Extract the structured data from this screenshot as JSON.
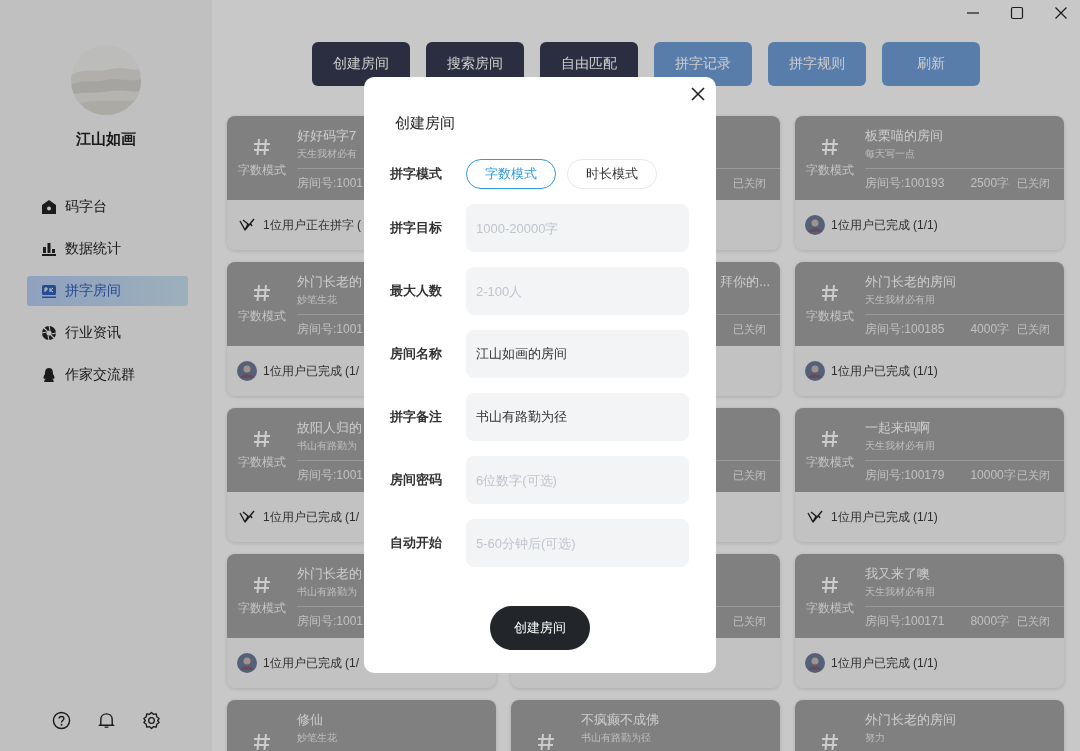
{
  "sidebar": {
    "user_name": "江山如画",
    "nav": [
      {
        "label": "码字台",
        "selected": false
      },
      {
        "label": "数据统计",
        "selected": false
      },
      {
        "label": "拼字房间",
        "selected": true
      },
      {
        "label": "行业资讯",
        "selected": false
      },
      {
        "label": "作家交流群",
        "selected": false
      }
    ]
  },
  "toolbar": [
    {
      "label": "创建房间",
      "kind": "dark"
    },
    {
      "label": "搜索房间",
      "kind": "dark"
    },
    {
      "label": "自由匹配",
      "kind": "dark"
    },
    {
      "label": "拼字记录",
      "kind": "light"
    },
    {
      "label": "拼字规则",
      "kind": "light"
    },
    {
      "label": "刷新",
      "kind": "light"
    }
  ],
  "rooms": [
    {
      "kind": "full",
      "mode": "字数模式",
      "title": "好好码字7",
      "subtitle": "天生我材必有",
      "room_no": "房间号:1001",
      "footer": {
        "kind": "pen",
        "text": "1位用户正在拼字 ("
      }
    },
    {
      "kind": "covered",
      "status": "已关闭"
    },
    {
      "kind": "full",
      "mode": "字数模式",
      "title": "板栗喵的房间",
      "subtitle": "每天写一点",
      "room_no": "房间号:100193",
      "target": "2500字",
      "status": "已关闭",
      "footer": {
        "kind": "avatar",
        "text": "1位用户已完成 (1/1)"
      }
    },
    {
      "kind": "full",
      "mode": "字数模式",
      "title": "外门长老的",
      "subtitle": "妙笔生花",
      "room_no": "房间号:1001",
      "footer": {
        "kind": "avatar",
        "text": "1位用户已完成 (1/"
      }
    },
    {
      "kind": "covered",
      "title": "拜你的...",
      "status": "已关闭"
    },
    {
      "kind": "full",
      "mode": "字数模式",
      "title": "外门长老的房间",
      "subtitle": "天生我材必有用",
      "room_no": "房间号:100185",
      "target": "4000字",
      "status": "已关闭",
      "footer": {
        "kind": "avatar",
        "text": "1位用户已完成 (1/1)"
      }
    },
    {
      "kind": "full",
      "mode": "字数模式",
      "title": "故阳人归的",
      "subtitle": "书山有路勤为",
      "room_no": "房间号:1001",
      "footer": {
        "kind": "pen",
        "text": "1位用户已完成 (1/"
      }
    },
    {
      "kind": "covered",
      "status": "已关闭"
    },
    {
      "kind": "full",
      "mode": "字数模式",
      "title": "一起来码啊",
      "subtitle": "天生我材必有用",
      "room_no": "房间号:100179",
      "target": "10000字",
      "status": "已关闭",
      "footer": {
        "kind": "pen",
        "text": "1位用户已完成 (1/1)"
      }
    },
    {
      "kind": "full",
      "mode": "字数模式",
      "title": "外门长老的",
      "subtitle": "书山有路勤为",
      "room_no": "房间号:1001",
      "footer": {
        "kind": "avatar",
        "text": "1位用户已完成 (1/"
      }
    },
    {
      "kind": "covered",
      "status": "已关闭"
    },
    {
      "kind": "full",
      "mode": "字数模式",
      "title": "我又来了噢",
      "subtitle": "天生我材必有用",
      "room_no": "房间号:100171",
      "target": "8000字",
      "status": "已关闭",
      "footer": {
        "kind": "avatar",
        "text": "1位用户已完成 (1/1)"
      }
    },
    {
      "kind": "full",
      "title": "修仙",
      "subtitle": "妙笔生花"
    },
    {
      "kind": "full",
      "title": "不疯癫不成佛",
      "subtitle": "书山有路勤为径"
    },
    {
      "kind": "full",
      "title": "外门长老的房间",
      "subtitle": "努力"
    }
  ],
  "dialog": {
    "title": "创建房间",
    "mode_label": "拼字模式",
    "modes": [
      {
        "label": "字数模式",
        "selected": true
      },
      {
        "label": "时长模式",
        "selected": false
      }
    ],
    "fields": [
      {
        "label": "拼字目标",
        "placeholder": "1000-20000字"
      },
      {
        "label": "最大人数",
        "placeholder": "2-100人"
      },
      {
        "label": "房间名称",
        "value": "江山如画的房间"
      },
      {
        "label": "拼字备注",
        "value": "书山有路勤为径"
      },
      {
        "label": "房间密码",
        "placeholder": "6位数字(可选)"
      },
      {
        "label": "自动开始",
        "placeholder": "5-60分钟后(可选)"
      }
    ],
    "submit": "创建房间"
  }
}
